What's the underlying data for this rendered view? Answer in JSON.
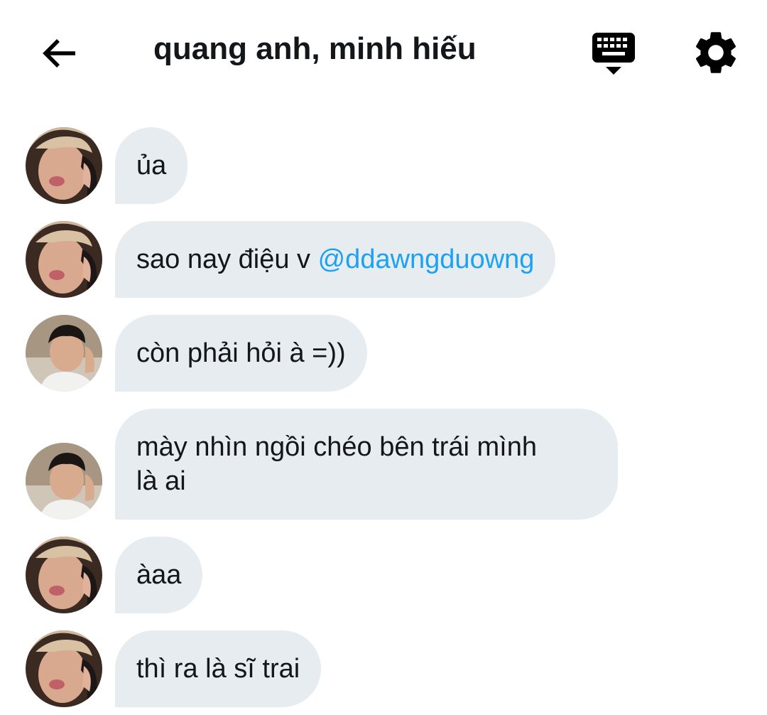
{
  "header": {
    "back_icon": "arrow-left-icon",
    "title": "quang anh, minh hiếu",
    "keyboard_icon": "keyboard-hide-icon",
    "settings_icon": "gear-icon"
  },
  "colors": {
    "bubble_bg": "#e6ecf0",
    "mention": "#1da1f2",
    "text": "#14171a"
  },
  "messages": [
    {
      "sender": "user-a",
      "text": "ủa"
    },
    {
      "sender": "user-a",
      "text_prefix": "sao nay điệu v ",
      "mention": "@ddawngduowng"
    },
    {
      "sender": "user-b",
      "text": "còn phải hỏi à =))"
    },
    {
      "sender": "user-b",
      "line1": "mày nhìn ngồi chéo bên trái mình",
      "line2": "là ai"
    },
    {
      "sender": "user-a",
      "text": "àaa"
    },
    {
      "sender": "user-a",
      "text": "thì ra là sĩ trai"
    }
  ]
}
